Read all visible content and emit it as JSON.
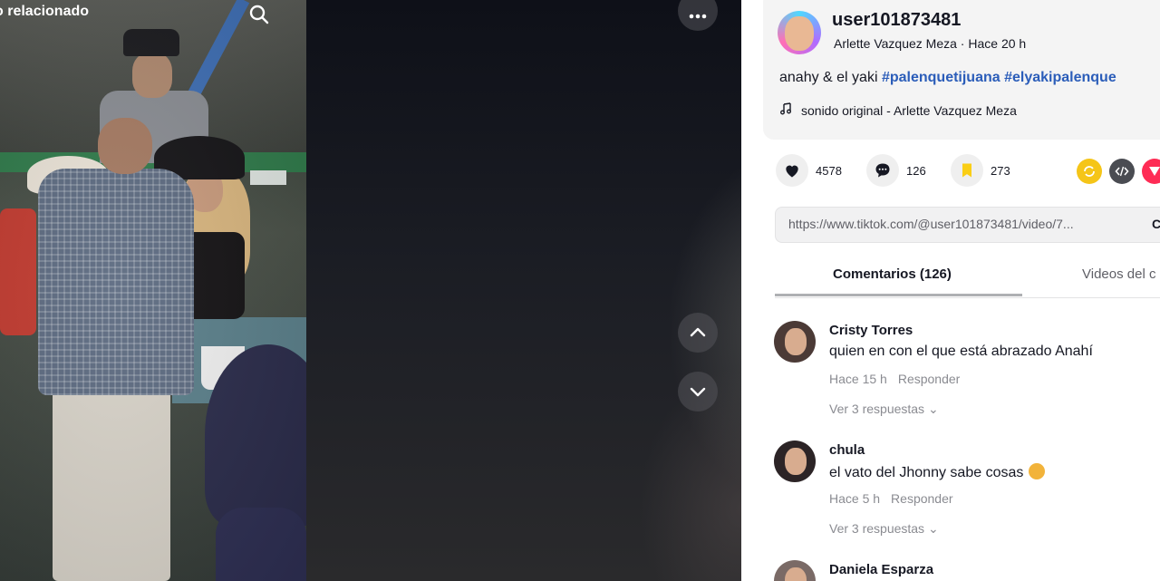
{
  "video": {
    "related_label": "o relacionado",
    "icons": {
      "search": "search-icon",
      "more": "more-horizontal-icon",
      "up": "chevron-up-icon",
      "down": "chevron-down-icon"
    }
  },
  "post": {
    "username": "user101873481",
    "author_name": "Arlette Vazquez Meza",
    "separator": " · ",
    "time_ago": "Hace 20 h",
    "caption_text": "anahy & el yaki ",
    "hashtags": [
      "#palenquetijuana",
      "#elyakipalenque"
    ],
    "music": "sonido original - Arlette Vazquez Meza"
  },
  "actions": {
    "likes": "4578",
    "comments": "126",
    "saves": "273",
    "share_icons": [
      "repost-icon",
      "embed-icon",
      "send-icon"
    ],
    "colors": {
      "like": "#161823",
      "save": "#face15",
      "repost": "#f5c518",
      "embed": "#4a4c52",
      "send": "#fe2c55"
    }
  },
  "link": {
    "url": "https://www.tiktok.com/@user101873481/video/7...",
    "copy_label": "Co"
  },
  "tabs": [
    {
      "label": "Comentarios (126)"
    },
    {
      "label": "Videos del c"
    }
  ],
  "comments": [
    {
      "name": "Cristy Torres",
      "text": "quien en con el que está abrazado Anahí",
      "time": "Hace 15 h",
      "reply": "Responder",
      "more": "Ver 3 respuestas ⌄"
    },
    {
      "name": "chula",
      "text": "el vato del Jhonny sabe cosas",
      "time": "Hace 5 h",
      "reply": "Responder",
      "more": "Ver 3 respuestas ⌄"
    },
    {
      "name": "Daniela Esparza",
      "text": "",
      "time": "",
      "reply": "",
      "more": ""
    }
  ]
}
